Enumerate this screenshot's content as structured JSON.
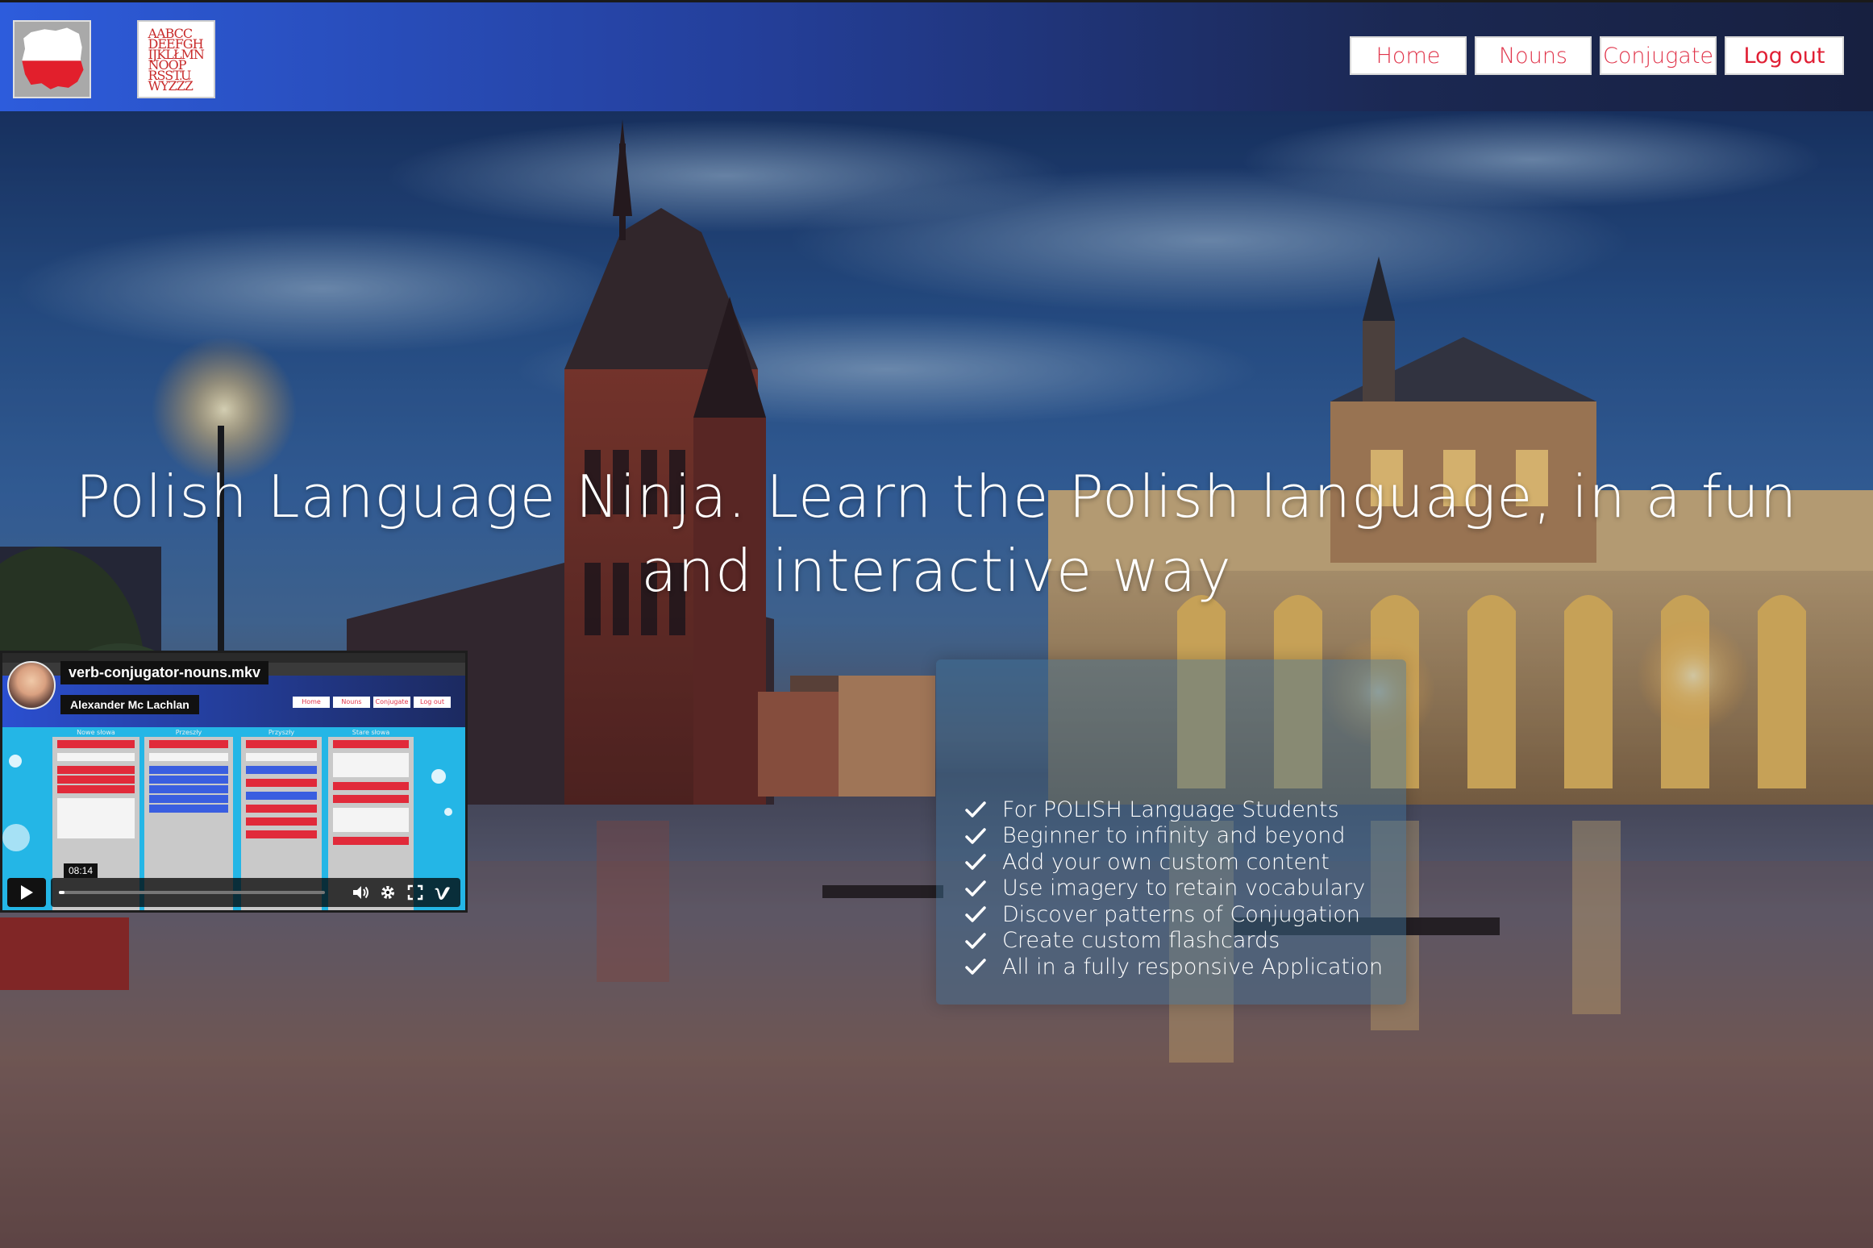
{
  "header": {
    "logo_flag_icon": "poland-map-flag-icon",
    "logo_alphabet_rows": [
      "AABCC",
      "DEEFGH",
      "IJKLŁMN",
      "NOOP",
      "RSSTU",
      "WYZŻŹ"
    ],
    "nav": [
      {
        "label": "Home"
      },
      {
        "label": "Nouns"
      },
      {
        "label": "Conjugate"
      },
      {
        "label": "Log out"
      }
    ],
    "accent_color": "#e0344a"
  },
  "hero": {
    "headline": "Polish Language Ninja. Learn the Polish language, in a fun and interactive way"
  },
  "features": {
    "icon": "check-icon",
    "items": [
      "For POLISH Language Students",
      "Beginner to infinity and beyond",
      "Add your own custom content",
      "Use imagery to retain vocabulary",
      "Discover patterns of Conjugation",
      "Create custom flashcards",
      "All in a fully responsive Application"
    ]
  },
  "video": {
    "title": "verb-conjugator-nouns.mkv",
    "author": "Alexander Mc Lachlan",
    "time": "08:14",
    "progress": 0.02,
    "mini_nav": [
      "Home",
      "Nouns",
      "Conjugate",
      "Log out"
    ],
    "column_headers": [
      "Nowe słowa",
      "Przeszły",
      "Przyszły",
      "Stare słowa"
    ],
    "icons": [
      "play-icon",
      "volume-icon",
      "settings-icon",
      "fullscreen-icon",
      "vimeo-icon"
    ]
  }
}
